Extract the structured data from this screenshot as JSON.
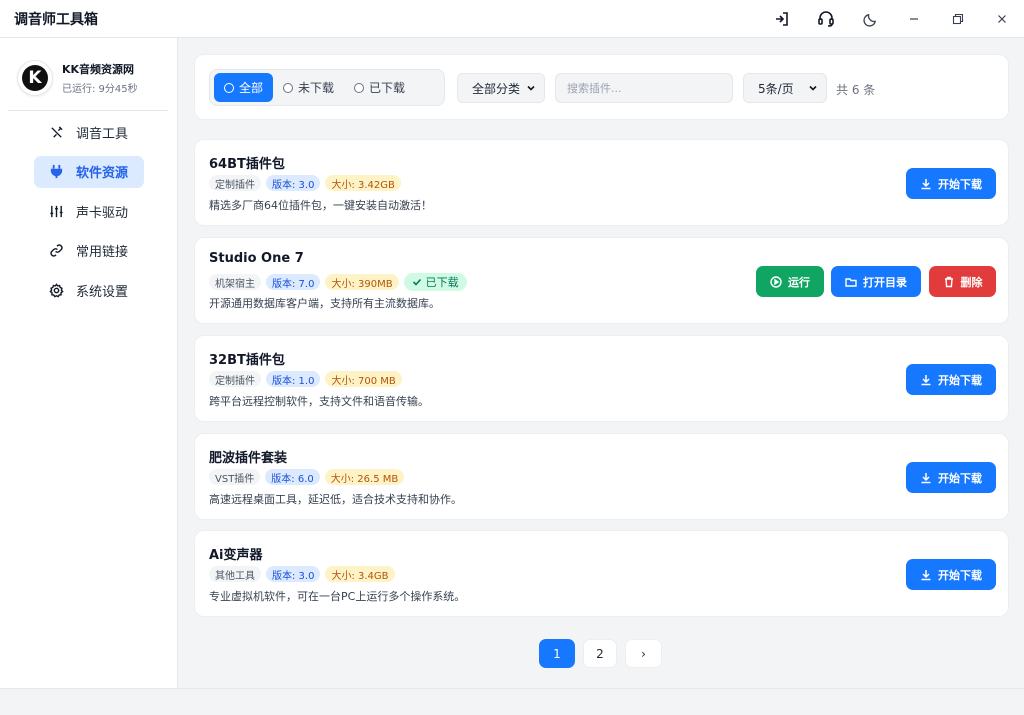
{
  "app": {
    "title": "调音师工具箱"
  },
  "titlebar": {
    "icons": [
      "logout-icon",
      "headset-icon",
      "moon-icon",
      "minimize-icon",
      "restore-icon",
      "close-icon"
    ]
  },
  "sidebar": {
    "brand_name": "KK音频资源网",
    "logo_letter": "K",
    "runtime": "已运行: 9分45秒",
    "items": [
      {
        "label": "调音工具",
        "icon": "tools-icon",
        "active": false
      },
      {
        "label": "软件资源",
        "icon": "plug-icon",
        "active": true
      },
      {
        "label": "声卡驱动",
        "icon": "sliders-icon",
        "active": false
      },
      {
        "label": "常用链接",
        "icon": "link-icon",
        "active": false
      },
      {
        "label": "系统设置",
        "icon": "gear-icon",
        "active": false
      }
    ]
  },
  "filters": {
    "status_options": [
      "全部",
      "未下载",
      "已下载"
    ],
    "status_selected": "全部",
    "category": "全部分类",
    "search_placeholder": "搜索插件...",
    "page_size": "5条/页",
    "total": "共 6 条"
  },
  "items": [
    {
      "title": "64BT插件包",
      "category": "定制插件",
      "version": "版本: 3.0",
      "size": "大小: 3.42GB",
      "desc": "精选多厂商64位插件包，一键安装自动激活！",
      "downloaded": false,
      "download_label": "开始下载"
    },
    {
      "title": "Studio One 7",
      "category": "机架宿主",
      "version": "版本: 7.0",
      "size": "大小: 390MB",
      "desc": "开源通用数据库客户端，支持所有主流数据库。",
      "downloaded": true,
      "done_label": "已下载",
      "run_label": "运行",
      "open_label": "打开目录",
      "delete_label": "删除"
    },
    {
      "title": "32BT插件包",
      "category": "定制插件",
      "version": "版本: 1.0",
      "size": "大小: 700 MB",
      "desc": "跨平台远程控制软件，支持文件和语音传输。",
      "downloaded": false,
      "download_label": "开始下载"
    },
    {
      "title": "肥波插件套装",
      "category": "VST插件",
      "version": "版本: 6.0",
      "size": "大小: 26.5 MB",
      "desc": "高速远程桌面工具，延迟低，适合技术支持和协作。",
      "downloaded": false,
      "download_label": "开始下载"
    },
    {
      "title": "Ai变声器",
      "category": "其他工具",
      "version": "版本: 3.0",
      "size": "大小: 3.4GB",
      "desc": "专业虚拟机软件，可在一台PC上运行多个操作系统。",
      "downloaded": false,
      "download_label": "开始下载"
    }
  ],
  "pagination": {
    "pages": [
      "1",
      "2"
    ],
    "current": "1",
    "next": "›"
  },
  "colors": {
    "primary": "#1677ff",
    "success": "#10a562",
    "danger": "#e23b3b",
    "nav_active_bg": "#dbeafe"
  }
}
